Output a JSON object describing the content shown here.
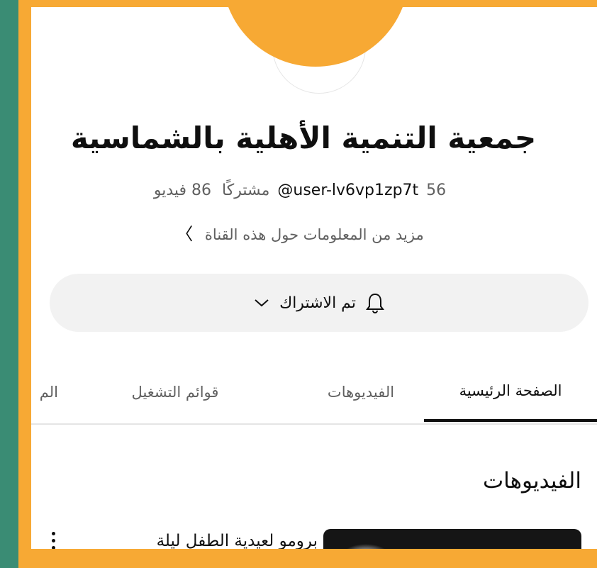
{
  "channel": {
    "name": "جمعية التنمية الأهلية بالشماسية",
    "handle": "@user-lv6vp1zp7t",
    "subscribers": "56 مشتركًا",
    "videos_count": "86 فيديو",
    "more_info": "مزيد من المعلومات حول هذه القناة",
    "more_info_icon": "chevron-right-icon"
  },
  "subscribe": {
    "label": "تم الاشتراك",
    "bell_icon": "bell-icon",
    "dropdown_icon": "chevron-down-icon"
  },
  "tabs": [
    {
      "label": "الصفحة الرئيسية",
      "active": true
    },
    {
      "label": "الفيديوهات",
      "active": false
    },
    {
      "label": "قوائم التشغيل",
      "active": false
    },
    {
      "label": "الم",
      "active": false
    }
  ],
  "sections": {
    "videos_title": "الفيديوهات"
  },
  "video": {
    "title": "برومو لعيدية الطفل ليلة",
    "menu_icon": "more-vert-icon"
  },
  "colors": {
    "frame": "#f7a934",
    "outer_background": "#3a8c74",
    "logo_green": "#2e8b6e",
    "logo_gold": "#e1a33a"
  }
}
